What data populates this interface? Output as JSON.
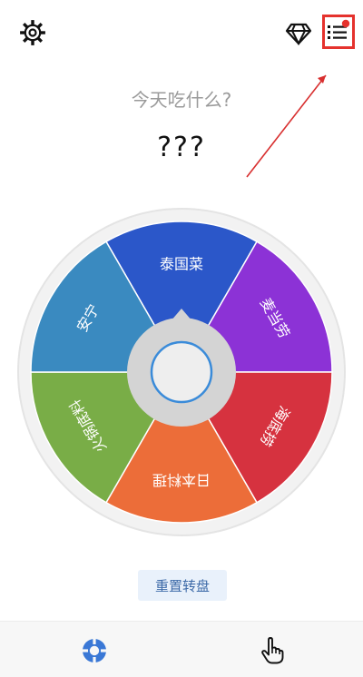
{
  "header": {
    "settings_icon": "gear-icon",
    "premium_icon": "diamond-icon",
    "menu_icon": "list-menu-icon",
    "notification_color": "#e5322d"
  },
  "main": {
    "question": "今天吃什么?",
    "result": "???"
  },
  "wheel": {
    "segments": [
      {
        "label": "泰国菜",
        "color": "#2b57c9"
      },
      {
        "label": "麦当劳",
        "color": "#8c32d6"
      },
      {
        "label": "海底捞",
        "color": "#d6323f"
      },
      {
        "label": "日本料理",
        "color": "#ec6d39"
      },
      {
        "label": "火锅底料",
        "color": "#79ad47"
      },
      {
        "label": "安宁",
        "color": "#3a8ac0"
      }
    ]
  },
  "buttons": {
    "reset_label": "重置转盘"
  },
  "bottom_nav": {
    "tabs": [
      {
        "name": "wheel",
        "icon": "lifebuoy-icon",
        "color": "#3a78d6"
      },
      {
        "name": "hand",
        "icon": "hand-pointer-icon",
        "color": "#111111"
      }
    ]
  }
}
